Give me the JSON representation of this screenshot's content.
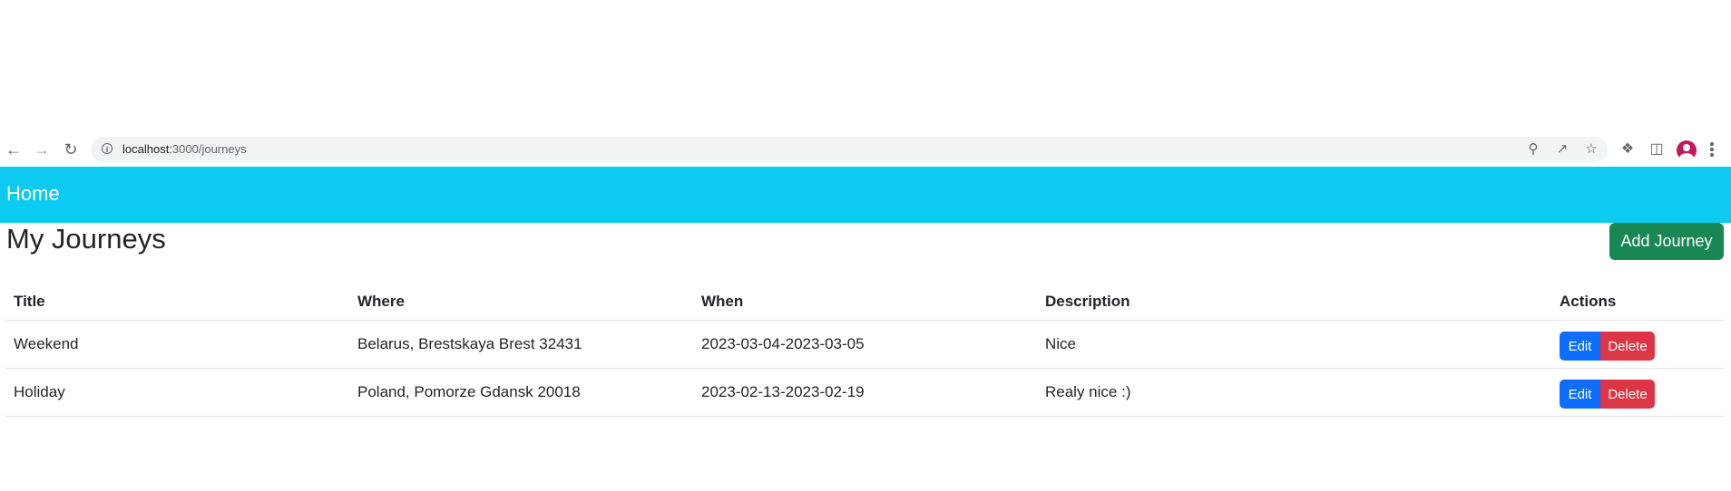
{
  "browser": {
    "url_host": "localhost",
    "url_path": ":3000/journeys"
  },
  "navbar": {
    "brand": "Home"
  },
  "page": {
    "title": "My Journeys",
    "add_button": "Add Journey"
  },
  "table": {
    "headers": [
      "Title",
      "Where",
      "When",
      "Description",
      "Actions"
    ],
    "rows": [
      {
        "title": "Weekend",
        "where": "Belarus, Brestskaya Brest 32431",
        "when": "2023-03-04-2023-03-05",
        "description": "Nice",
        "edit": "Edit",
        "delete": "Delete"
      },
      {
        "title": "Holiday",
        "where": "Poland, Pomorze Gdansk 20018",
        "when": "2023-02-13-2023-02-19",
        "description": "Realy nice :)",
        "edit": "Edit",
        "delete": "Delete"
      }
    ]
  },
  "colors": {
    "navbar": "#0dcaf0",
    "add_button": "#198754",
    "edit_button": "#0d6efd",
    "delete_button": "#dc3545",
    "avatar": "#c2185b"
  },
  "icons": [
    "back-arrow-icon",
    "forward-arrow-icon",
    "reload-icon",
    "info-icon",
    "zoom-icon",
    "share-icon",
    "star-icon",
    "extensions-icon",
    "side-panel-icon",
    "profile-avatar",
    "more-menu-icon"
  ]
}
